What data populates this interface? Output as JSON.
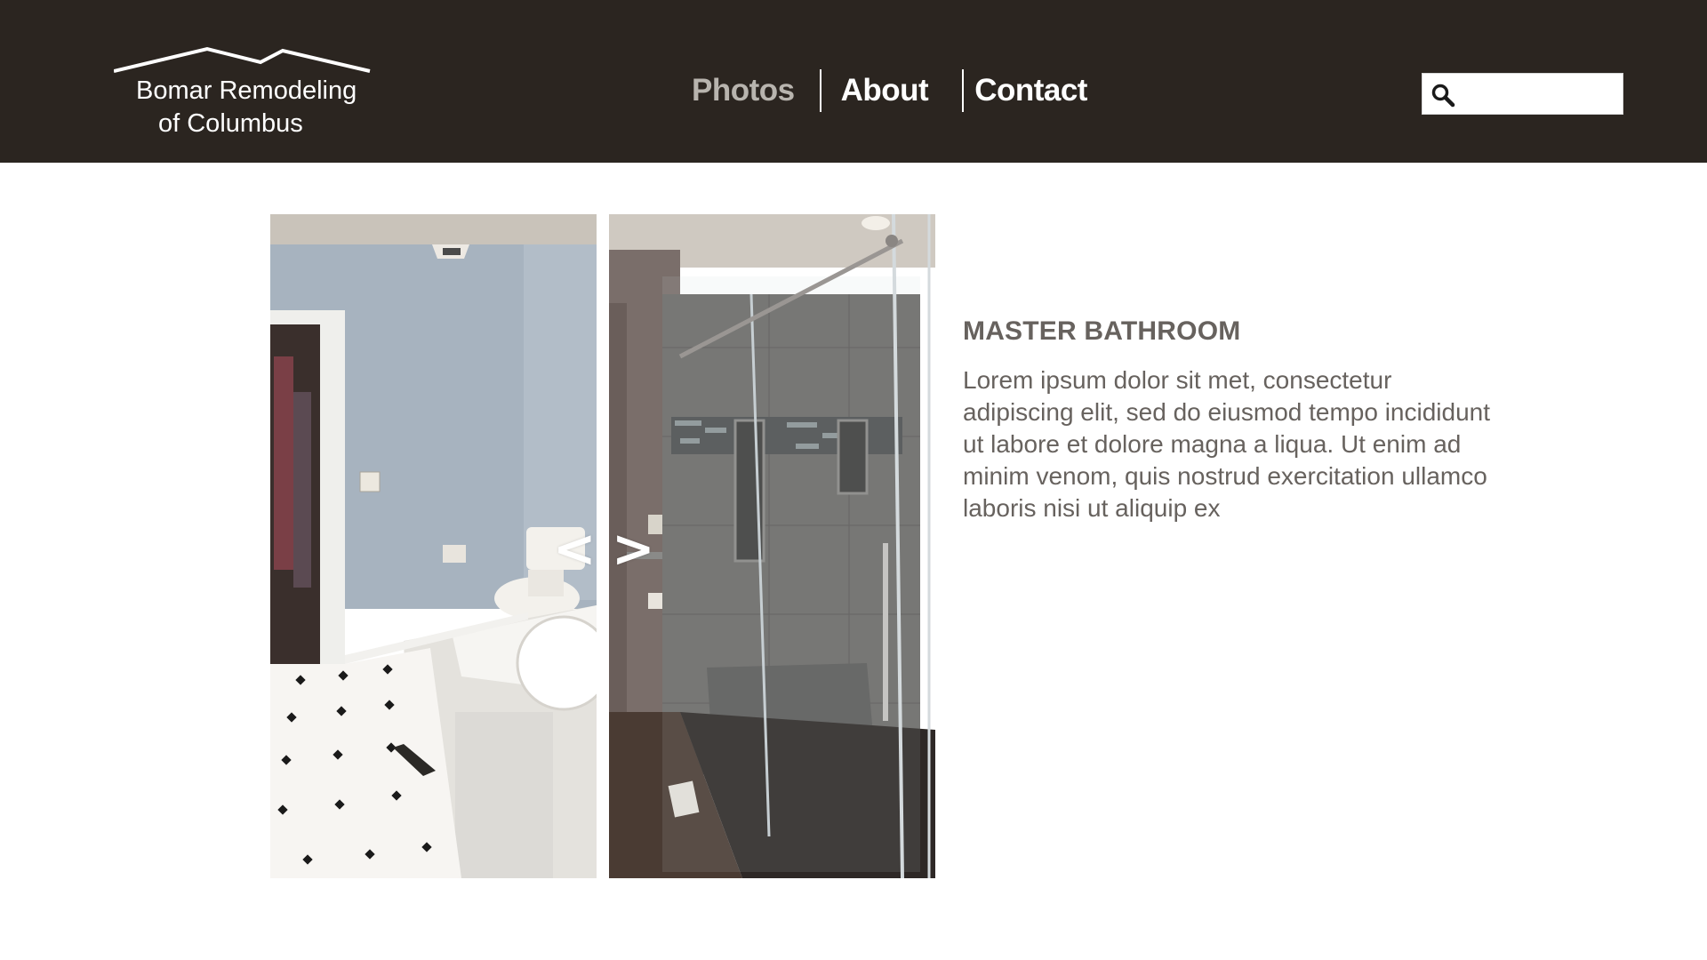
{
  "header": {
    "logo": {
      "line1": "Bomar Remodeling",
      "line2": "of Columbus"
    },
    "nav": [
      {
        "label": "Photos",
        "active": true
      },
      {
        "label": "About",
        "active": false
      },
      {
        "label": "Contact",
        "active": false
      }
    ],
    "search": {
      "placeholder": "",
      "value": ""
    }
  },
  "gallery": {
    "prev_label": "<",
    "next_label": ">",
    "images": [
      "bathroom-before-photo",
      "bathroom-after-photo"
    ]
  },
  "project": {
    "title": "MASTER BATHROOM",
    "description": "Lorem ipsum dolor sit met, consectetur adipiscing elit, sed do eiusmod tempo incididunt ut labore et dolore magna a liqua. Ut enim ad minim venom, quis nostrud exercitation ullamco laboris nisi ut aliquip ex"
  },
  "colors": {
    "header_bg": "#2b2520",
    "nav_active": "#b8b4ae",
    "body_text": "#67625e"
  }
}
